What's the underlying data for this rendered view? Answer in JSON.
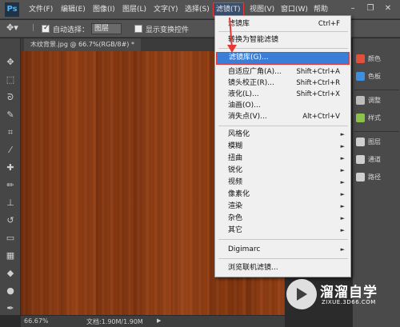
{
  "app": {
    "logo": "Ps"
  },
  "menubar": {
    "items": [
      "文件(F)",
      "编辑(E)",
      "图像(I)",
      "图层(L)",
      "文字(Y)",
      "选择(S)",
      "滤镜(T)",
      "视图(V)",
      "窗口(W)",
      "帮助"
    ],
    "active_index": 6
  },
  "window_controls": {
    "minimize": "–",
    "restore": "❐",
    "close": "✕"
  },
  "options_bar": {
    "auto_select_label": "自动选择：",
    "auto_select_checked": true,
    "auto_select_value": "图层",
    "show_transform_label": "显示变换控件",
    "show_transform_checked": false
  },
  "document": {
    "tab_title": "木纹背景.jpg @ 66.7%(RGB/8#)",
    "tab_modified": "*"
  },
  "status": {
    "zoom": "66.67%",
    "doc_info": "文档:1.90M/1.90M"
  },
  "filter_menu": {
    "items": [
      {
        "label": "滤镜库",
        "shortcut": "Ctrl+F"
      },
      {
        "label": "转换为智能滤镜",
        "shortcut": ""
      },
      {
        "label": "滤镜库(G)...",
        "shortcut": "",
        "highlighted": true
      },
      {
        "label": "自适应广角(A)...",
        "shortcut": "Shift+Ctrl+A"
      },
      {
        "label": "镜头校正(R)...",
        "shortcut": "Shift+Ctrl+R"
      },
      {
        "label": "液化(L)...",
        "shortcut": "Shift+Ctrl+X"
      },
      {
        "label": "油画(O)...",
        "shortcut": ""
      },
      {
        "label": "消失点(V)...",
        "shortcut": "Alt+Ctrl+V"
      },
      {
        "label": "风格化",
        "submenu": true
      },
      {
        "label": "模糊",
        "submenu": true
      },
      {
        "label": "扭曲",
        "submenu": true
      },
      {
        "label": "锐化",
        "submenu": true
      },
      {
        "label": "视频",
        "submenu": true
      },
      {
        "label": "像素化",
        "submenu": true
      },
      {
        "label": "渲染",
        "submenu": true
      },
      {
        "label": "杂色",
        "submenu": true
      },
      {
        "label": "其它",
        "submenu": true
      },
      {
        "label": "Digimarc",
        "submenu": true
      },
      {
        "label": "浏览联机滤镜...",
        "shortcut": ""
      }
    ],
    "submenu_arrow": "►"
  },
  "panels": {
    "items": [
      {
        "label": "颜色",
        "color": "#e0503c"
      },
      {
        "label": "色板",
        "color": "#3f8fe0"
      },
      {
        "label": "调整",
        "color": "#bdbdbd"
      },
      {
        "label": "样式",
        "color": "#8bc34a"
      },
      {
        "label": "图层",
        "color": "#cfcfcf"
      },
      {
        "label": "通道",
        "color": "#cfcfcf"
      },
      {
        "label": "路径",
        "color": "#cfcfcf"
      }
    ]
  },
  "watermark": {
    "title": "溜溜自学",
    "url": "ZIXUE.3D66.COM"
  },
  "colors": {
    "highlight": "#3a7ed8",
    "annotation_red": "#e53935"
  }
}
